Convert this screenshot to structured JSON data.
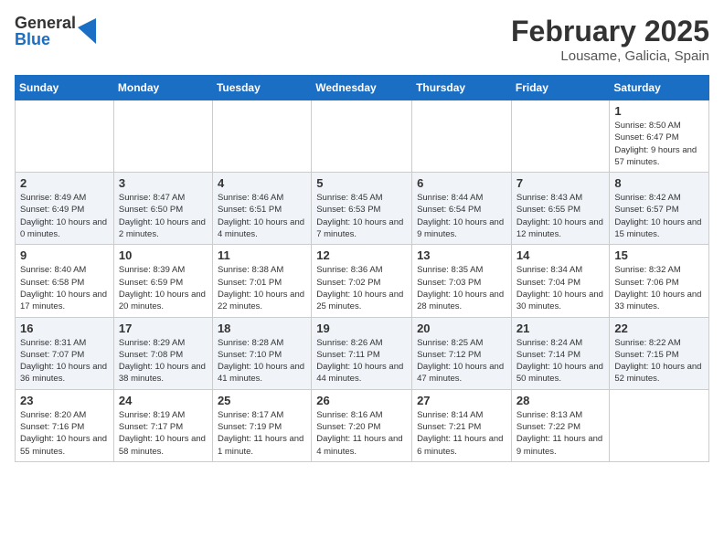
{
  "logo": {
    "general": "General",
    "blue": "Blue"
  },
  "title": "February 2025",
  "location": "Lousame, Galicia, Spain",
  "weekdays": [
    "Sunday",
    "Monday",
    "Tuesday",
    "Wednesday",
    "Thursday",
    "Friday",
    "Saturday"
  ],
  "weeks": [
    [
      {
        "day": "",
        "info": ""
      },
      {
        "day": "",
        "info": ""
      },
      {
        "day": "",
        "info": ""
      },
      {
        "day": "",
        "info": ""
      },
      {
        "day": "",
        "info": ""
      },
      {
        "day": "",
        "info": ""
      },
      {
        "day": "1",
        "info": "Sunrise: 8:50 AM\nSunset: 6:47 PM\nDaylight: 9 hours and 57 minutes."
      }
    ],
    [
      {
        "day": "2",
        "info": "Sunrise: 8:49 AM\nSunset: 6:49 PM\nDaylight: 10 hours and 0 minutes."
      },
      {
        "day": "3",
        "info": "Sunrise: 8:47 AM\nSunset: 6:50 PM\nDaylight: 10 hours and 2 minutes."
      },
      {
        "day": "4",
        "info": "Sunrise: 8:46 AM\nSunset: 6:51 PM\nDaylight: 10 hours and 4 minutes."
      },
      {
        "day": "5",
        "info": "Sunrise: 8:45 AM\nSunset: 6:53 PM\nDaylight: 10 hours and 7 minutes."
      },
      {
        "day": "6",
        "info": "Sunrise: 8:44 AM\nSunset: 6:54 PM\nDaylight: 10 hours and 9 minutes."
      },
      {
        "day": "7",
        "info": "Sunrise: 8:43 AM\nSunset: 6:55 PM\nDaylight: 10 hours and 12 minutes."
      },
      {
        "day": "8",
        "info": "Sunrise: 8:42 AM\nSunset: 6:57 PM\nDaylight: 10 hours and 15 minutes."
      }
    ],
    [
      {
        "day": "9",
        "info": "Sunrise: 8:40 AM\nSunset: 6:58 PM\nDaylight: 10 hours and 17 minutes."
      },
      {
        "day": "10",
        "info": "Sunrise: 8:39 AM\nSunset: 6:59 PM\nDaylight: 10 hours and 20 minutes."
      },
      {
        "day": "11",
        "info": "Sunrise: 8:38 AM\nSunset: 7:01 PM\nDaylight: 10 hours and 22 minutes."
      },
      {
        "day": "12",
        "info": "Sunrise: 8:36 AM\nSunset: 7:02 PM\nDaylight: 10 hours and 25 minutes."
      },
      {
        "day": "13",
        "info": "Sunrise: 8:35 AM\nSunset: 7:03 PM\nDaylight: 10 hours and 28 minutes."
      },
      {
        "day": "14",
        "info": "Sunrise: 8:34 AM\nSunset: 7:04 PM\nDaylight: 10 hours and 30 minutes."
      },
      {
        "day": "15",
        "info": "Sunrise: 8:32 AM\nSunset: 7:06 PM\nDaylight: 10 hours and 33 minutes."
      }
    ],
    [
      {
        "day": "16",
        "info": "Sunrise: 8:31 AM\nSunset: 7:07 PM\nDaylight: 10 hours and 36 minutes."
      },
      {
        "day": "17",
        "info": "Sunrise: 8:29 AM\nSunset: 7:08 PM\nDaylight: 10 hours and 38 minutes."
      },
      {
        "day": "18",
        "info": "Sunrise: 8:28 AM\nSunset: 7:10 PM\nDaylight: 10 hours and 41 minutes."
      },
      {
        "day": "19",
        "info": "Sunrise: 8:26 AM\nSunset: 7:11 PM\nDaylight: 10 hours and 44 minutes."
      },
      {
        "day": "20",
        "info": "Sunrise: 8:25 AM\nSunset: 7:12 PM\nDaylight: 10 hours and 47 minutes."
      },
      {
        "day": "21",
        "info": "Sunrise: 8:24 AM\nSunset: 7:14 PM\nDaylight: 10 hours and 50 minutes."
      },
      {
        "day": "22",
        "info": "Sunrise: 8:22 AM\nSunset: 7:15 PM\nDaylight: 10 hours and 52 minutes."
      }
    ],
    [
      {
        "day": "23",
        "info": "Sunrise: 8:20 AM\nSunset: 7:16 PM\nDaylight: 10 hours and 55 minutes."
      },
      {
        "day": "24",
        "info": "Sunrise: 8:19 AM\nSunset: 7:17 PM\nDaylight: 10 hours and 58 minutes."
      },
      {
        "day": "25",
        "info": "Sunrise: 8:17 AM\nSunset: 7:19 PM\nDaylight: 11 hours and 1 minute."
      },
      {
        "day": "26",
        "info": "Sunrise: 8:16 AM\nSunset: 7:20 PM\nDaylight: 11 hours and 4 minutes."
      },
      {
        "day": "27",
        "info": "Sunrise: 8:14 AM\nSunset: 7:21 PM\nDaylight: 11 hours and 6 minutes."
      },
      {
        "day": "28",
        "info": "Sunrise: 8:13 AM\nSunset: 7:22 PM\nDaylight: 11 hours and 9 minutes."
      },
      {
        "day": "",
        "info": ""
      }
    ]
  ]
}
